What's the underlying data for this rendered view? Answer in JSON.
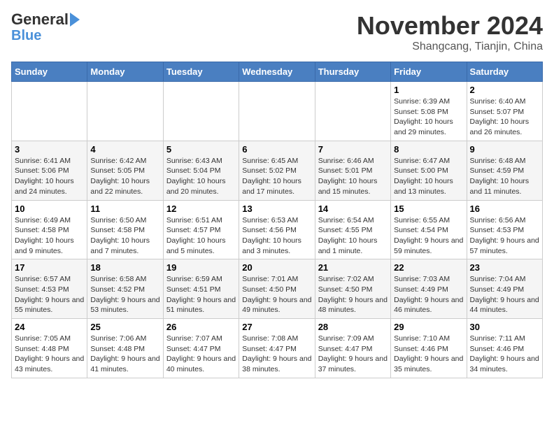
{
  "header": {
    "logo_general": "General",
    "logo_blue": "Blue",
    "month_title": "November 2024",
    "location": "Shangcang, Tianjin, China"
  },
  "days_of_week": [
    "Sunday",
    "Monday",
    "Tuesday",
    "Wednesday",
    "Thursday",
    "Friday",
    "Saturday"
  ],
  "weeks": [
    [
      {
        "day": "",
        "info": ""
      },
      {
        "day": "",
        "info": ""
      },
      {
        "day": "",
        "info": ""
      },
      {
        "day": "",
        "info": ""
      },
      {
        "day": "",
        "info": ""
      },
      {
        "day": "1",
        "info": "Sunrise: 6:39 AM\nSunset: 5:08 PM\nDaylight: 10 hours and 29 minutes."
      },
      {
        "day": "2",
        "info": "Sunrise: 6:40 AM\nSunset: 5:07 PM\nDaylight: 10 hours and 26 minutes."
      }
    ],
    [
      {
        "day": "3",
        "info": "Sunrise: 6:41 AM\nSunset: 5:06 PM\nDaylight: 10 hours and 24 minutes."
      },
      {
        "day": "4",
        "info": "Sunrise: 6:42 AM\nSunset: 5:05 PM\nDaylight: 10 hours and 22 minutes."
      },
      {
        "day": "5",
        "info": "Sunrise: 6:43 AM\nSunset: 5:04 PM\nDaylight: 10 hours and 20 minutes."
      },
      {
        "day": "6",
        "info": "Sunrise: 6:45 AM\nSunset: 5:02 PM\nDaylight: 10 hours and 17 minutes."
      },
      {
        "day": "7",
        "info": "Sunrise: 6:46 AM\nSunset: 5:01 PM\nDaylight: 10 hours and 15 minutes."
      },
      {
        "day": "8",
        "info": "Sunrise: 6:47 AM\nSunset: 5:00 PM\nDaylight: 10 hours and 13 minutes."
      },
      {
        "day": "9",
        "info": "Sunrise: 6:48 AM\nSunset: 4:59 PM\nDaylight: 10 hours and 11 minutes."
      }
    ],
    [
      {
        "day": "10",
        "info": "Sunrise: 6:49 AM\nSunset: 4:58 PM\nDaylight: 10 hours and 9 minutes."
      },
      {
        "day": "11",
        "info": "Sunrise: 6:50 AM\nSunset: 4:58 PM\nDaylight: 10 hours and 7 minutes."
      },
      {
        "day": "12",
        "info": "Sunrise: 6:51 AM\nSunset: 4:57 PM\nDaylight: 10 hours and 5 minutes."
      },
      {
        "day": "13",
        "info": "Sunrise: 6:53 AM\nSunset: 4:56 PM\nDaylight: 10 hours and 3 minutes."
      },
      {
        "day": "14",
        "info": "Sunrise: 6:54 AM\nSunset: 4:55 PM\nDaylight: 10 hours and 1 minute."
      },
      {
        "day": "15",
        "info": "Sunrise: 6:55 AM\nSunset: 4:54 PM\nDaylight: 9 hours and 59 minutes."
      },
      {
        "day": "16",
        "info": "Sunrise: 6:56 AM\nSunset: 4:53 PM\nDaylight: 9 hours and 57 minutes."
      }
    ],
    [
      {
        "day": "17",
        "info": "Sunrise: 6:57 AM\nSunset: 4:53 PM\nDaylight: 9 hours and 55 minutes."
      },
      {
        "day": "18",
        "info": "Sunrise: 6:58 AM\nSunset: 4:52 PM\nDaylight: 9 hours and 53 minutes."
      },
      {
        "day": "19",
        "info": "Sunrise: 6:59 AM\nSunset: 4:51 PM\nDaylight: 9 hours and 51 minutes."
      },
      {
        "day": "20",
        "info": "Sunrise: 7:01 AM\nSunset: 4:50 PM\nDaylight: 9 hours and 49 minutes."
      },
      {
        "day": "21",
        "info": "Sunrise: 7:02 AM\nSunset: 4:50 PM\nDaylight: 9 hours and 48 minutes."
      },
      {
        "day": "22",
        "info": "Sunrise: 7:03 AM\nSunset: 4:49 PM\nDaylight: 9 hours and 46 minutes."
      },
      {
        "day": "23",
        "info": "Sunrise: 7:04 AM\nSunset: 4:49 PM\nDaylight: 9 hours and 44 minutes."
      }
    ],
    [
      {
        "day": "24",
        "info": "Sunrise: 7:05 AM\nSunset: 4:48 PM\nDaylight: 9 hours and 43 minutes."
      },
      {
        "day": "25",
        "info": "Sunrise: 7:06 AM\nSunset: 4:48 PM\nDaylight: 9 hours and 41 minutes."
      },
      {
        "day": "26",
        "info": "Sunrise: 7:07 AM\nSunset: 4:47 PM\nDaylight: 9 hours and 40 minutes."
      },
      {
        "day": "27",
        "info": "Sunrise: 7:08 AM\nSunset: 4:47 PM\nDaylight: 9 hours and 38 minutes."
      },
      {
        "day": "28",
        "info": "Sunrise: 7:09 AM\nSunset: 4:47 PM\nDaylight: 9 hours and 37 minutes."
      },
      {
        "day": "29",
        "info": "Sunrise: 7:10 AM\nSunset: 4:46 PM\nDaylight: 9 hours and 35 minutes."
      },
      {
        "day": "30",
        "info": "Sunrise: 7:11 AM\nSunset: 4:46 PM\nDaylight: 9 hours and 34 minutes."
      }
    ]
  ]
}
